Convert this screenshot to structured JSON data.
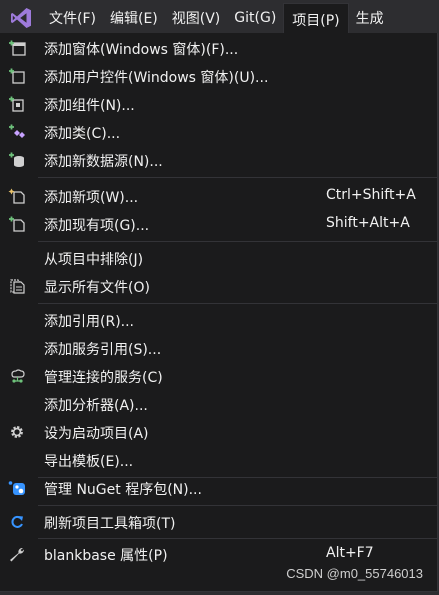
{
  "menubar": {
    "items": [
      {
        "label": "文件(F)"
      },
      {
        "label": "编辑(E)"
      },
      {
        "label": "视图(V)"
      },
      {
        "label": "Git(G)"
      },
      {
        "label": "项目(P)"
      },
      {
        "label": "生成"
      }
    ]
  },
  "menu": {
    "items": [
      {
        "label": "添加窗体(Windows 窗体)(F)...",
        "shortcut": "",
        "icon": "add-form-icon"
      },
      {
        "label": "添加用户控件(Windows 窗体)(U)...",
        "shortcut": "",
        "icon": "add-user-control-icon"
      },
      {
        "label": "添加组件(N)...",
        "shortcut": "",
        "icon": "add-component-icon"
      },
      {
        "label": "添加类(C)...",
        "shortcut": "",
        "icon": "add-class-icon"
      },
      {
        "label": "添加新数据源(N)...",
        "shortcut": "",
        "icon": "add-datasource-icon"
      },
      {
        "label": "添加新项(W)...",
        "shortcut": "Ctrl+Shift+A",
        "icon": "add-new-item-icon"
      },
      {
        "label": "添加现有项(G)...",
        "shortcut": "Shift+Alt+A",
        "icon": "add-existing-item-icon"
      },
      {
        "label": "从项目中排除(J)",
        "shortcut": "",
        "icon": ""
      },
      {
        "label": "显示所有文件(O)",
        "shortcut": "",
        "icon": "show-all-files-icon"
      },
      {
        "label": "添加引用(R)...",
        "shortcut": "",
        "icon": ""
      },
      {
        "label": "添加服务引用(S)...",
        "shortcut": "",
        "icon": ""
      },
      {
        "label": "管理连接的服务(C)",
        "shortcut": "",
        "icon": "connected-services-icon"
      },
      {
        "label": "添加分析器(A)...",
        "shortcut": "",
        "icon": ""
      },
      {
        "label": "设为启动项目(A)",
        "shortcut": "",
        "icon": "gear-icon"
      },
      {
        "label": "导出模板(E)...",
        "shortcut": "",
        "icon": ""
      },
      {
        "label": "管理 NuGet 程序包(N)...",
        "shortcut": "",
        "icon": "nuget-icon"
      },
      {
        "label": "刷新项目工具箱项(T)",
        "shortcut": "",
        "icon": "refresh-icon"
      },
      {
        "label": "blankbase 属性(P)",
        "shortcut": "Alt+F7",
        "icon": "wrench-icon"
      }
    ]
  },
  "watermark": "CSDN @m0_55746013",
  "colors": {
    "menu_background": "#1b1b1c",
    "menubar_background": "#2d2d30",
    "text": "#f1f1f1",
    "hover": "#333334",
    "vs_purple": "#9e7bdb",
    "icon_green": "#6ec27b",
    "icon_blue": "#3794ff"
  }
}
